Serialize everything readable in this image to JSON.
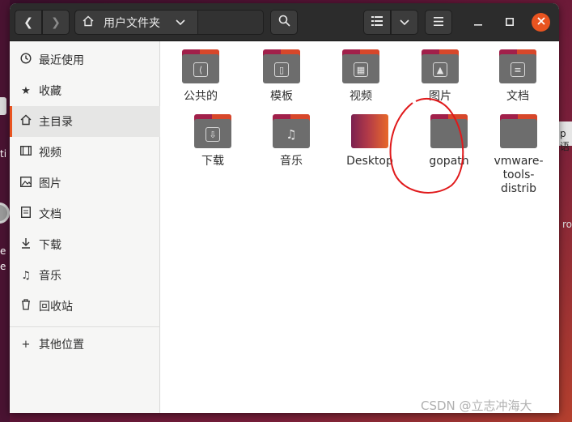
{
  "desktop": {
    "left_texts": [
      "ti",
      "e",
      "e"
    ],
    "right_texts": [
      "p语",
      "ro"
    ]
  },
  "headerbar": {
    "back_icon": "chevron-left-icon",
    "forward_icon": "chevron-right-icon",
    "path_label": "用户文件夹",
    "path_icon": "home-icon",
    "search_icon": "search-icon",
    "view_icon": "list-view-icon",
    "view_menu_icon": "chevron-down-icon",
    "menu_icon": "hamburger-menu-icon",
    "window_controls": [
      "minimize",
      "maximize",
      "close"
    ]
  },
  "sidebar": {
    "items": [
      {
        "label": "最近使用",
        "icon": "clock-icon"
      },
      {
        "label": "收藏",
        "icon": "star-icon"
      },
      {
        "label": "主目录",
        "icon": "home-icon"
      },
      {
        "label": "视频",
        "icon": "film-icon"
      },
      {
        "label": "图片",
        "icon": "image-icon"
      },
      {
        "label": "文档",
        "icon": "document-icon"
      },
      {
        "label": "下载",
        "icon": "download-icon"
      },
      {
        "label": "音乐",
        "icon": "music-icon"
      },
      {
        "label": "回收站",
        "icon": "trash-icon"
      }
    ],
    "other": {
      "label": "其他位置",
      "icon": "plus-icon"
    }
  },
  "files": [
    {
      "name": "公共的",
      "icon": "share-icon"
    },
    {
      "name": "模板",
      "icon": "template-icon"
    },
    {
      "name": "视频",
      "icon": "film-icon"
    },
    {
      "name": "图片",
      "icon": "image-icon"
    },
    {
      "name": "文档",
      "icon": "document-icon"
    },
    {
      "name": "下载",
      "icon": "download-icon"
    },
    {
      "name": "音乐",
      "icon": "music-icon"
    },
    {
      "name": "Desktop",
      "icon": "desktop-folder-icon"
    },
    {
      "name": "gopath",
      "icon": "folder-icon"
    },
    {
      "name": "vmware-tools-distrib",
      "icon": "folder-icon"
    }
  ],
  "annotation": {
    "color": "#e0191b",
    "target": "gopath"
  },
  "watermark": "CSDN @立志冲海大",
  "colors": {
    "accent": "#e95420",
    "folder_tab": "#a1204a",
    "folder_body": "#6d6d6d",
    "headerbar": "#2c2c2c"
  }
}
